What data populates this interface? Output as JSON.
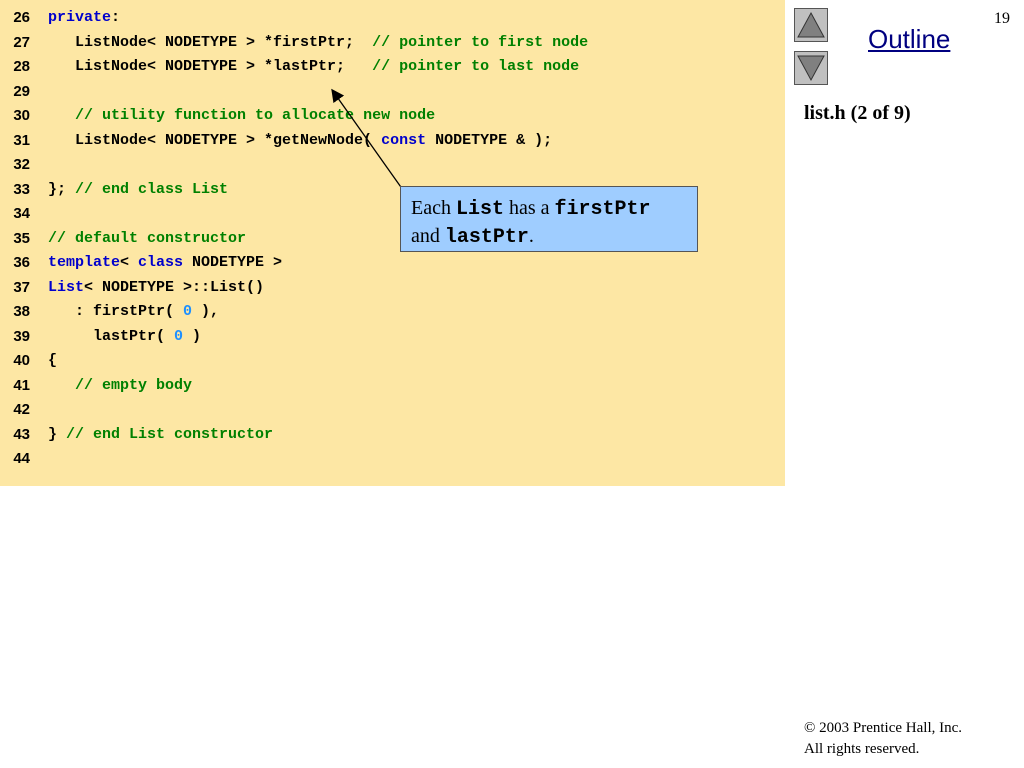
{
  "header": {
    "page_number": "19",
    "outline_label": "Outline",
    "subtitle": "list.h (2 of 9)"
  },
  "nav": {
    "up_icon": "triangle-up-icon",
    "down_icon": "triangle-down-icon"
  },
  "code": {
    "lines": [
      {
        "num": "26",
        "segments": [
          {
            "t": "private",
            "c": "kw"
          },
          {
            "t": ":",
            "c": "pl"
          }
        ]
      },
      {
        "num": "27",
        "segments": [
          {
            "t": "   ListNode< NODETYPE > *firstPtr;  ",
            "c": "pl"
          },
          {
            "t": "// pointer to first node",
            "c": "cm"
          }
        ]
      },
      {
        "num": "28",
        "segments": [
          {
            "t": "   ListNode< NODETYPE > *lastPtr;   ",
            "c": "pl"
          },
          {
            "t": "// pointer to last node",
            "c": "cm"
          }
        ]
      },
      {
        "num": "29",
        "segments": []
      },
      {
        "num": "30",
        "segments": [
          {
            "t": "   ",
            "c": "pl"
          },
          {
            "t": "// utility function to allocate new node",
            "c": "cm"
          }
        ]
      },
      {
        "num": "31",
        "segments": [
          {
            "t": "   ListNode< NODETYPE > *getNewNode( ",
            "c": "pl"
          },
          {
            "t": "const",
            "c": "kw"
          },
          {
            "t": " NODETYPE & );",
            "c": "pl"
          }
        ]
      },
      {
        "num": "32",
        "segments": []
      },
      {
        "num": "33",
        "segments": [
          {
            "t": "}; ",
            "c": "pl"
          },
          {
            "t": "// end class List",
            "c": "cm"
          }
        ]
      },
      {
        "num": "34",
        "segments": []
      },
      {
        "num": "35",
        "segments": [
          {
            "t": "// default constructor",
            "c": "cm"
          }
        ]
      },
      {
        "num": "36",
        "segments": [
          {
            "t": "template",
            "c": "kw"
          },
          {
            "t": "< ",
            "c": "pl"
          },
          {
            "t": "class",
            "c": "kw"
          },
          {
            "t": " NODETYPE >",
            "c": "pl"
          }
        ]
      },
      {
        "num": "37",
        "segments": [
          {
            "t": "List",
            "c": "kw"
          },
          {
            "t": "< NODETYPE >::List()",
            "c": "pl"
          }
        ]
      },
      {
        "num": "38",
        "segments": [
          {
            "t": "   : firstPtr( ",
            "c": "pl"
          },
          {
            "t": "0",
            "c": "num"
          },
          {
            "t": " ),",
            "c": "pl"
          }
        ]
      },
      {
        "num": "39",
        "segments": [
          {
            "t": "     lastPtr( ",
            "c": "pl"
          },
          {
            "t": "0",
            "c": "num"
          },
          {
            "t": " )",
            "c": "pl"
          }
        ]
      },
      {
        "num": "40",
        "segments": [
          {
            "t": "{",
            "c": "pl"
          }
        ]
      },
      {
        "num": "41",
        "segments": [
          {
            "t": "   ",
            "c": "pl"
          },
          {
            "t": "// empty body",
            "c": "cm"
          }
        ]
      },
      {
        "num": "42",
        "segments": []
      },
      {
        "num": "43",
        "segments": [
          {
            "t": "} ",
            "c": "pl"
          },
          {
            "t": "// end List constructor",
            "c": "cm"
          }
        ]
      },
      {
        "num": "44",
        "segments": []
      }
    ]
  },
  "callout": {
    "p1": "Each ",
    "m1": "List",
    "p2": " has a ",
    "m2": "firstPtr",
    "p3": "and ",
    "m3": "lastPtr",
    "p4": "."
  },
  "footer": {
    "line1": "© 2003 Prentice Hall, Inc.",
    "line2": "All rights reserved."
  }
}
